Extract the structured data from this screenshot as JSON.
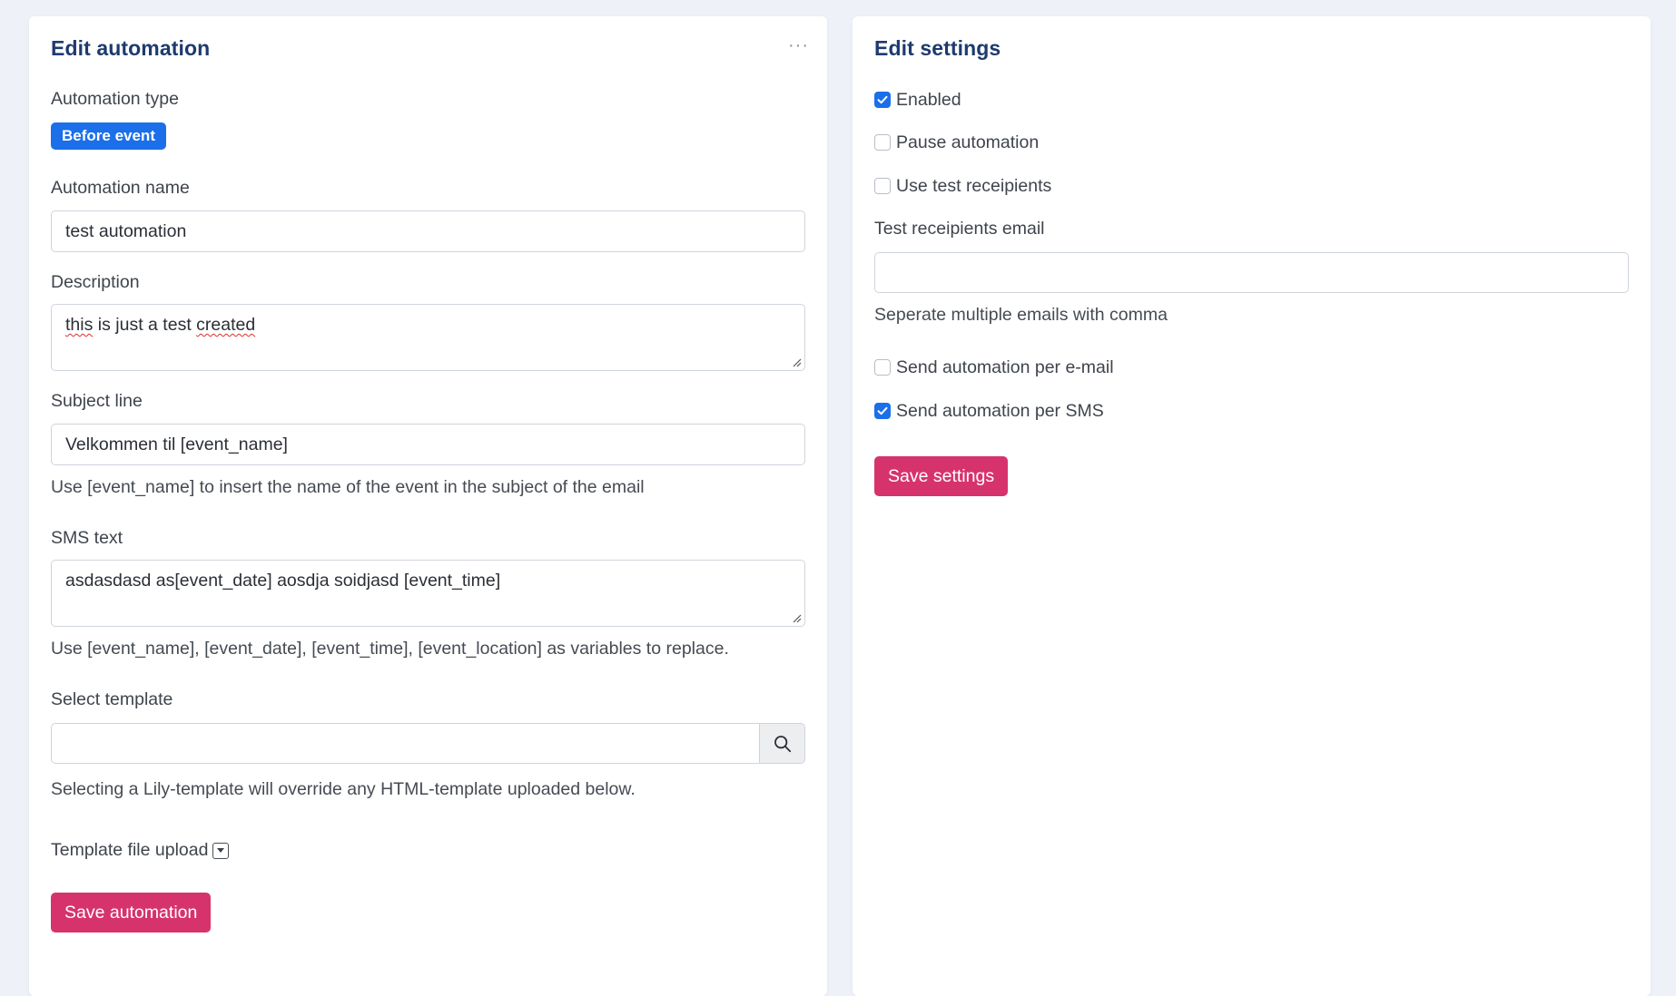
{
  "edit_automation": {
    "title": "Edit automation",
    "automation_type_label": "Automation type",
    "automation_type_value": "Before event",
    "automation_name_label": "Automation name",
    "automation_name_value": "test automation",
    "description_label": "Description",
    "description_words": [
      "this",
      " is just a test ",
      "created"
    ],
    "subject_line_label": "Subject line",
    "subject_line_value": "Velkommen til [event_name]",
    "subject_line_hint": "Use [event_name] to insert the name of the event in the subject of the email",
    "sms_text_label": "SMS text",
    "sms_text_value": "asdasdasd as[event_date] aosdja soidjasd [event_time]",
    "sms_text_hint": "Use [event_name], [event_date], [event_time], [event_location] as variables to replace.",
    "select_template_label": "Select template",
    "select_template_value": "",
    "select_template_hint": "Selecting a Lily-template will override any HTML-template uploaded below.",
    "template_file_upload_label": "Template file upload",
    "save_label": "Save automation",
    "menu_dots": "···"
  },
  "edit_settings": {
    "title": "Edit settings",
    "checkboxes": [
      {
        "label": "Enabled",
        "checked": true
      },
      {
        "label": "Pause automation",
        "checked": false
      },
      {
        "label": "Use test receipients",
        "checked": false
      }
    ],
    "test_email_label": "Test receipients email",
    "test_email_value": "",
    "test_email_hint": "Seperate multiple emails with comma",
    "send_checkboxes": [
      {
        "label": "Send automation per e-mail",
        "checked": false
      },
      {
        "label": "Send automation per SMS",
        "checked": true
      }
    ],
    "save_label": "Save settings"
  },
  "colors": {
    "page_bg": "#eef1f8",
    "title": "#1e3a6e",
    "badge": "#1b6fe9",
    "checkbox_checked": "#1b6fe9",
    "primary_button": "#d6336c"
  },
  "icons": {
    "search": "search-icon",
    "menu": "more-horizontal-icon",
    "upload_toggle": "caret-down-square-icon",
    "checkmark": "check-icon"
  }
}
